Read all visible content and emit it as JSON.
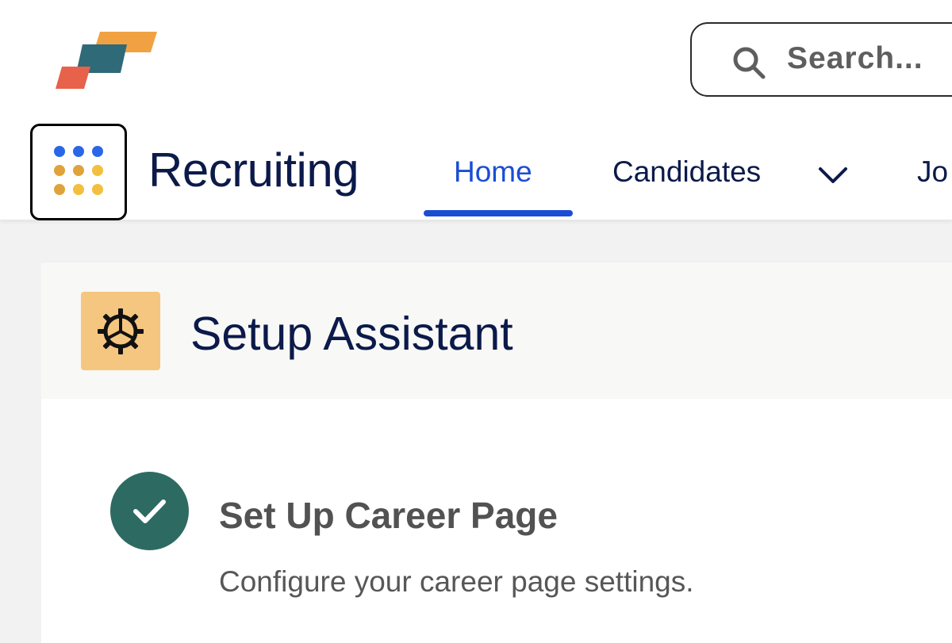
{
  "header": {
    "search": {
      "placeholder": "Search..."
    },
    "app_name": "Recruiting",
    "nav_tabs": [
      {
        "label": "Home",
        "active": true
      },
      {
        "label": "Candidates",
        "has_dropdown": true
      },
      {
        "label": "Jo"
      }
    ]
  },
  "setup_assistant": {
    "title": "Setup Assistant",
    "step": {
      "title": "Set Up Career Page",
      "description": "Configure your career page settings.",
      "status": "complete"
    }
  },
  "colors": {
    "accent": "#1b4dd4",
    "nav_text": "#0b1a4a",
    "step_complete": "#2d6b62",
    "setup_icon_bg": "#f5c680",
    "logo_red": "#e8614a",
    "logo_teal": "#2e6a78",
    "logo_orange": "#f0a243"
  }
}
